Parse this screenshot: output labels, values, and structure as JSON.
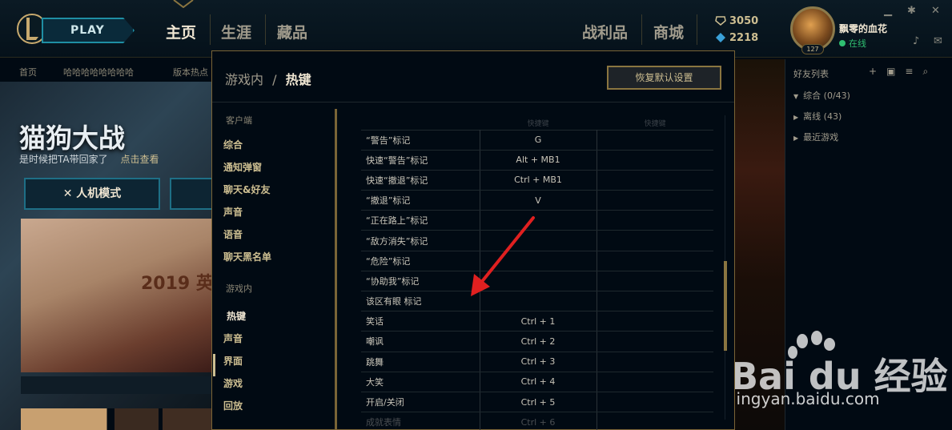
{
  "topnav": {
    "play_label": "PLAY",
    "items": [
      "主页",
      "生涯",
      "藏品",
      "战利品",
      "商城"
    ],
    "currency": {
      "rp": "3050",
      "be": "2218"
    },
    "profile": {
      "name": "飘零的血花",
      "status": "在线",
      "level": "127"
    }
  },
  "home": {
    "subnav": [
      "首页",
      "哈哈哈哈哈哈哈哈",
      "版本热点"
    ],
    "event_title": "猫狗大战",
    "event_sub": "是时候把TA带回家了",
    "event_sub_link": "点击查看",
    "mode_button": "人机模式",
    "promo_year": "2019 英"
  },
  "modal": {
    "breadcrumb_parent": "游戏内",
    "breadcrumb_sep": "/",
    "breadcrumb_current": "热键",
    "reset_label": "恢复默认设置",
    "sections": [
      {
        "head": "客户端",
        "items": [
          "综合",
          "通知弹窗",
          "聊天&好友",
          "声音",
          "语音",
          "聊天黑名单"
        ]
      },
      {
        "head": "游戏内",
        "items": [
          "热键",
          "声音",
          "界面",
          "游戏",
          "回放"
        ]
      }
    ],
    "table_headers": [
      "快捷键",
      "快捷键"
    ],
    "rows": [
      [
        "“警告”标记",
        "G",
        ""
      ],
      [
        "快速“警告”标记",
        "Alt + MB1",
        ""
      ],
      [
        "快速“撤退”标记",
        "Ctrl + MB1",
        ""
      ],
      [
        "“撤退”标记",
        "V",
        ""
      ],
      [
        "“正在路上”标记",
        "",
        ""
      ],
      [
        "“敌方消失”标记",
        "",
        ""
      ],
      [
        "“危险”标记",
        "",
        ""
      ],
      [
        "“协助我”标记",
        "",
        ""
      ],
      [
        "该区有眼 标记",
        "",
        ""
      ],
      [
        "笑话",
        "Ctrl + 1",
        ""
      ],
      [
        "嘲讽",
        "Ctrl + 2",
        ""
      ],
      [
        "跳舞",
        "Ctrl + 3",
        ""
      ],
      [
        "大笑",
        "Ctrl + 4",
        ""
      ],
      [
        "开启/关闭",
        "Ctrl + 5",
        ""
      ],
      [
        "成就表情",
        "Ctrl + 6",
        ""
      ]
    ]
  },
  "friends": {
    "title": "好友列表",
    "groups": [
      "综合 (0/43)",
      "离线 (43)",
      "最近游戏"
    ]
  },
  "watermark": {
    "brand": "Bai du 经验",
    "url": "jingyan.baidu.com"
  }
}
